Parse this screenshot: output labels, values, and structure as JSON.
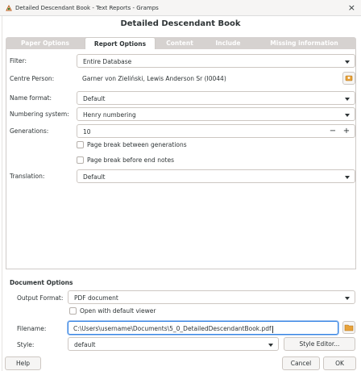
{
  "window": {
    "title": "Detailed Descendant Book - Text Reports - Gramps",
    "close_glyph": "×",
    "heading": "Detailed Descendant Book"
  },
  "tabs": [
    {
      "label": "Paper Options",
      "active": false
    },
    {
      "label": "Report Options",
      "active": true
    },
    {
      "label": "Content",
      "active": false
    },
    {
      "label": "Include",
      "active": false
    },
    {
      "label": "Missing information",
      "active": false
    }
  ],
  "report_options": {
    "filter_label": "Filter:",
    "filter_value": "Entire Database",
    "centre_person_label": "Centre Person:",
    "centre_person_value": "Garner von Zieliński, Lewis Anderson Sr (I0044)",
    "name_format_label": "Name format:",
    "name_format_value": "Default",
    "numbering_label": "Numbering system:",
    "numbering_value": "Henry numbering",
    "generations_label": "Generations:",
    "generations_value": "10",
    "minus_glyph": "−",
    "plus_glyph": "+",
    "page_break_generations": "Page break between generations",
    "page_break_endnotes": "Page break before end notes",
    "translation_label": "Translation:",
    "translation_value": "Default"
  },
  "document_options": {
    "section_title": "Document Options",
    "output_format_label": "Output Format:",
    "output_format_value": "PDF document",
    "open_default_viewer": "Open with default viewer",
    "filename_label": "Filename:",
    "filename_value": "C:\\Users\\username\\Documents\\5_0_DetailedDescendantBook.pdf",
    "style_label": "Style:",
    "style_value": "default",
    "style_editor_button": "Style Editor..."
  },
  "footer": {
    "help_button": "Help",
    "cancel_button": "Cancel",
    "ok_button": "OK"
  },
  "colors": {
    "accent_focus": "#3584e4",
    "tab_inactive_bg": "#d6d2d0",
    "icon_orange": "#e8a23a"
  }
}
